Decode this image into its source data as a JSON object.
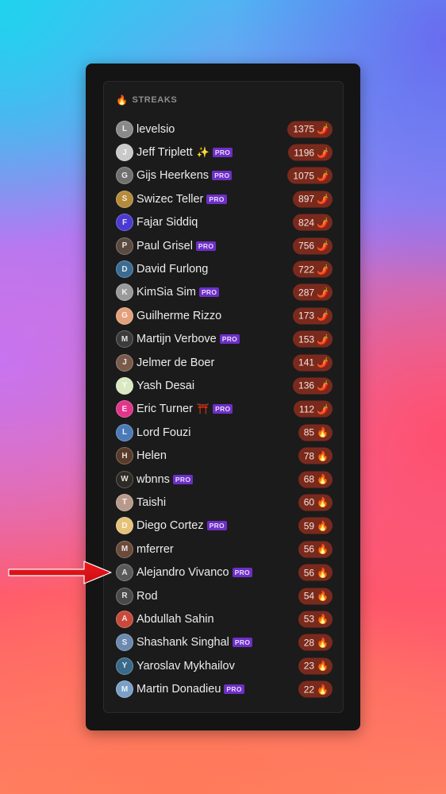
{
  "panel": {
    "title": "STREAKS",
    "title_icon": "🔥"
  },
  "colors": {
    "pro_badge": "#6d2fc4",
    "streak_badge": "#7a2a1d",
    "annotation_arrow": "#e8151b"
  },
  "users": [
    {
      "name": "levelsio",
      "pro": false,
      "emoji": "",
      "streak": "1375",
      "icon": "🌶️",
      "avatar_color": "#8a8a8a",
      "initial": "L"
    },
    {
      "name": "Jeff Triplett",
      "pro": true,
      "emoji": "✨",
      "streak": "1196",
      "icon": "🌶️",
      "avatar_color": "#c9c9c9",
      "initial": "J"
    },
    {
      "name": "Gijs Heerkens",
      "pro": true,
      "emoji": "",
      "streak": "1075",
      "icon": "🌶️",
      "avatar_color": "#707070",
      "initial": "G"
    },
    {
      "name": "Swizec Teller",
      "pro": true,
      "emoji": "",
      "streak": "897",
      "icon": "🌶️",
      "avatar_color": "#b58a3a",
      "initial": "S"
    },
    {
      "name": "Fajar Siddiq",
      "pro": false,
      "emoji": "",
      "streak": "824",
      "icon": "🌶️",
      "avatar_color": "#4b3ad1",
      "initial": "F"
    },
    {
      "name": "Paul Grisel",
      "pro": true,
      "emoji": "",
      "streak": "756",
      "icon": "🌶️",
      "avatar_color": "#5a4a3f",
      "initial": "P"
    },
    {
      "name": "David Furlong",
      "pro": false,
      "emoji": "",
      "streak": "722",
      "icon": "🌶️",
      "avatar_color": "#3a6c93",
      "initial": "D"
    },
    {
      "name": "KimSia Sim",
      "pro": true,
      "emoji": "",
      "streak": "287",
      "icon": "🌶️",
      "avatar_color": "#9a9a9a",
      "initial": "K"
    },
    {
      "name": "Guilherme Rizzo",
      "pro": false,
      "emoji": "",
      "streak": "173",
      "icon": "🌶️",
      "avatar_color": "#e3a07a",
      "initial": "G"
    },
    {
      "name": "Martijn Verbove",
      "pro": true,
      "emoji": "",
      "streak": "153",
      "icon": "🌶️",
      "avatar_color": "#3b3b3b",
      "initial": "M"
    },
    {
      "name": "Jelmer de Boer",
      "pro": false,
      "emoji": "",
      "streak": "141",
      "icon": "🌶️",
      "avatar_color": "#7a5a4a",
      "initial": "J"
    },
    {
      "name": "Yash Desai",
      "pro": false,
      "emoji": "",
      "streak": "136",
      "icon": "🌶️",
      "avatar_color": "#d9e8c2",
      "initial": "Y"
    },
    {
      "name": "Eric Turner",
      "pro": true,
      "emoji": "⛩️",
      "streak": "112",
      "icon": "🌶️",
      "avatar_color": "#e0358a",
      "initial": "E"
    },
    {
      "name": "Lord Fouzi",
      "pro": false,
      "emoji": "",
      "streak": "85",
      "icon": "🔥",
      "avatar_color": "#4a7ab8",
      "initial": "L"
    },
    {
      "name": "Helen",
      "pro": false,
      "emoji": "",
      "streak": "78",
      "icon": "🔥",
      "avatar_color": "#5a3a2a",
      "initial": "H"
    },
    {
      "name": "wbnns",
      "pro": true,
      "emoji": "",
      "streak": "68",
      "icon": "🔥",
      "avatar_color": "#2e2a24",
      "initial": "W"
    },
    {
      "name": "Taishi",
      "pro": false,
      "emoji": "",
      "streak": "60",
      "icon": "🔥",
      "avatar_color": "#b89a8a",
      "initial": "T"
    },
    {
      "name": "Diego Cortez",
      "pro": true,
      "emoji": "",
      "streak": "59",
      "icon": "🔥",
      "avatar_color": "#e6c27a",
      "initial": "D"
    },
    {
      "name": "mferrer",
      "pro": false,
      "emoji": "",
      "streak": "56",
      "icon": "🔥",
      "avatar_color": "#6a4a3a",
      "initial": "M"
    },
    {
      "name": "Alejandro Vivanco",
      "pro": true,
      "emoji": "",
      "streak": "56",
      "icon": "🔥",
      "avatar_color": "#5a5a5a",
      "initial": "A"
    },
    {
      "name": "Rod",
      "pro": false,
      "emoji": "",
      "streak": "54",
      "icon": "🔥",
      "avatar_color": "#4a4a4a",
      "initial": "R"
    },
    {
      "name": "Abdullah Sahin",
      "pro": false,
      "emoji": "",
      "streak": "53",
      "icon": "🔥",
      "avatar_color": "#c84a3a",
      "initial": "A"
    },
    {
      "name": "Shashank Singhal",
      "pro": true,
      "emoji": "",
      "streak": "28",
      "icon": "🔥",
      "avatar_color": "#6a8ab0",
      "initial": "S"
    },
    {
      "name": "Yaroslav Mykhailov",
      "pro": false,
      "emoji": "",
      "streak": "23",
      "icon": "🔥",
      "avatar_color": "#3a6a8a",
      "initial": "Y"
    },
    {
      "name": "Martin Donadieu",
      "pro": true,
      "emoji": "",
      "streak": "22",
      "icon": "🔥",
      "avatar_color": "#7aa0c8",
      "initial": "M"
    }
  ],
  "pro_label": "PRO",
  "annotation": {
    "arrow_icon": "red-arrow-right",
    "points_to": "Alejandro Vivanco"
  }
}
